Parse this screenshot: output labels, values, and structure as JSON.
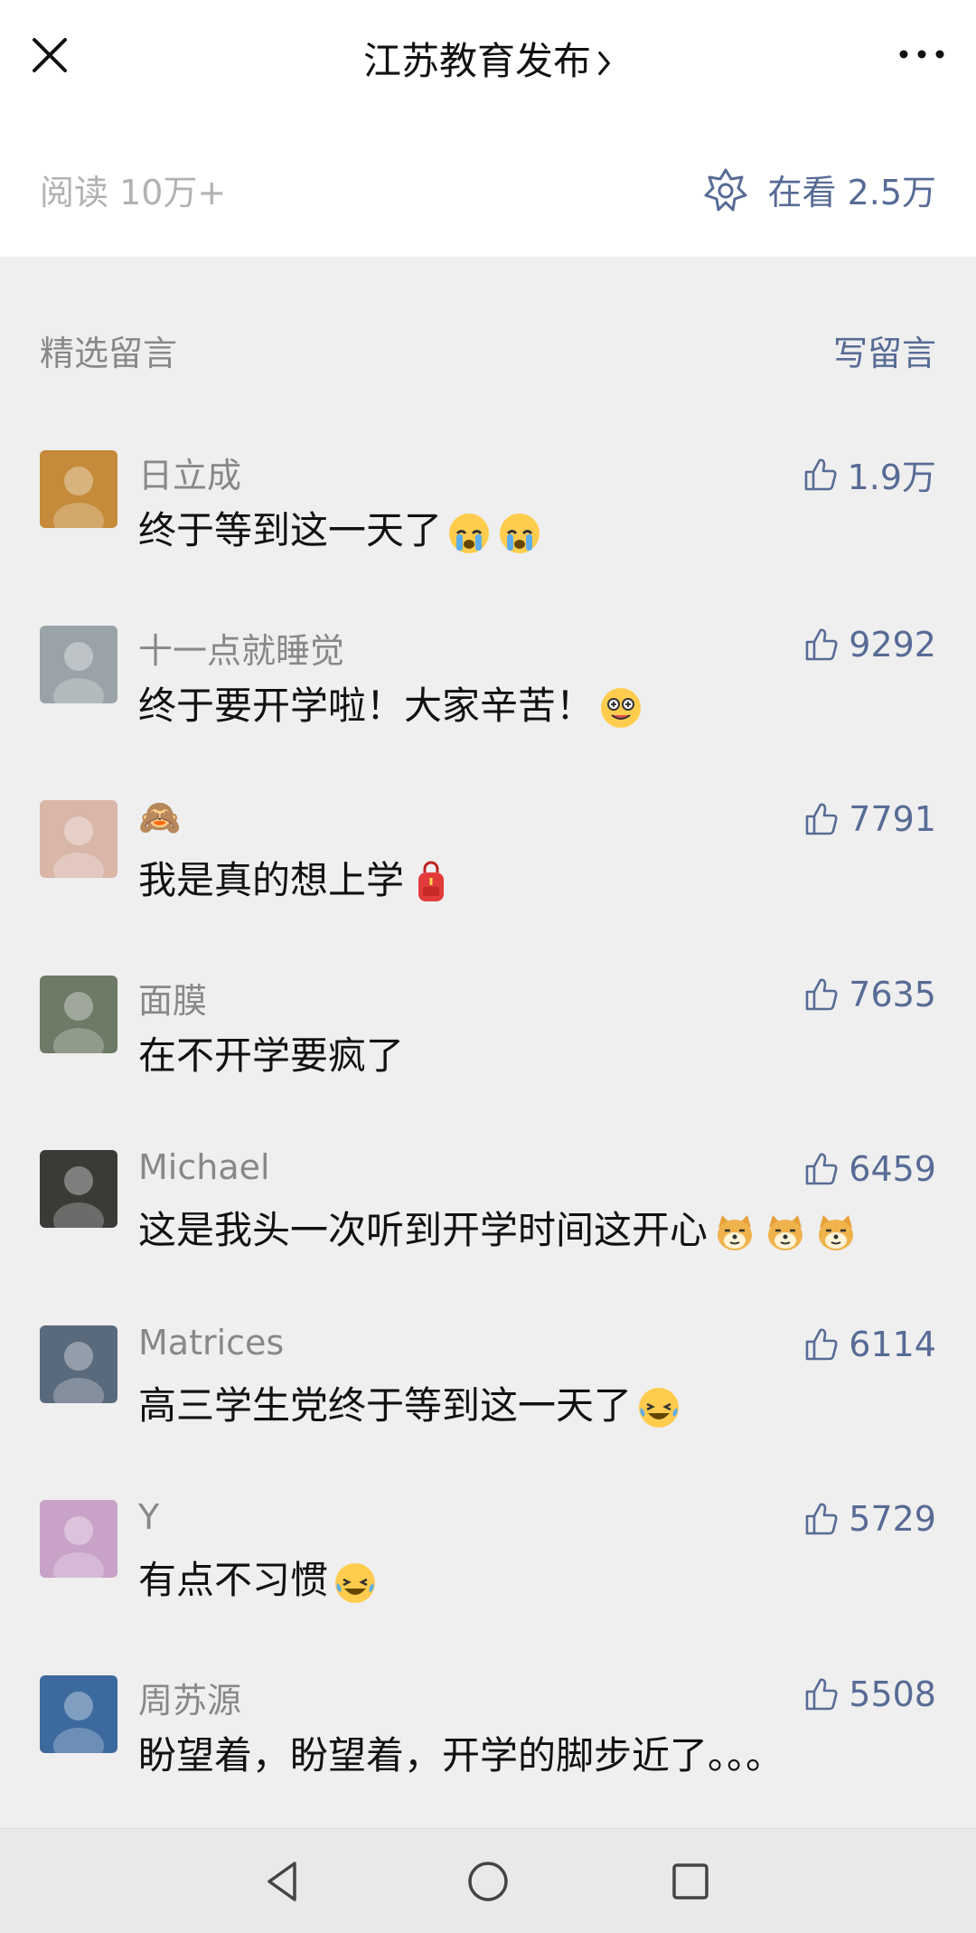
{
  "header": {
    "account_name": "江苏教育发布",
    "close_icon": "close-icon",
    "more_icon": "more-dots-icon"
  },
  "stats": {
    "reads": "阅读 10万+",
    "watching": "在看 2.5万",
    "watching_icon": "wow-star-icon"
  },
  "section": {
    "title": "精选留言",
    "write_label": "写留言"
  },
  "comments": [
    {
      "nickname": "日立成",
      "text": "终于等到这一天了",
      "emojis": [
        "crying-face",
        "crying-face"
      ],
      "likes": "1.9万",
      "avatar_color": "#c58b3a"
    },
    {
      "nickname": "十一点就睡觉",
      "text": "终于要开学啦！大家辛苦！",
      "emojis": [
        "dizzy-tongue-face"
      ],
      "likes": "9292",
      "avatar_color": "#9aa3a8"
    },
    {
      "nickname": "🙈",
      "text": "我是真的想上学",
      "emojis": [
        "school-backpack"
      ],
      "likes": "7791",
      "avatar_color": "#d9b6a8"
    },
    {
      "nickname": "面膜",
      "text": "在不开学要疯了",
      "emojis": [],
      "likes": "7635",
      "avatar_color": "#6d7a66"
    },
    {
      "nickname": "Michael",
      "text": "这是我头一次听到开学时间这开心",
      "emojis": [
        "doge",
        "doge",
        "doge"
      ],
      "likes": "6459",
      "avatar_color": "#3b3a37"
    },
    {
      "nickname": "Matrices",
      "text": "高三学生党终于等到这一天了",
      "emojis": [
        "laughing-tears-face"
      ],
      "likes": "6114",
      "avatar_color": "#5a6a7d"
    },
    {
      "nickname": "Y",
      "text": "有点不习惯",
      "emojis": [
        "laughing-tears-face"
      ],
      "likes": "5729",
      "avatar_color": "#c9a2c8"
    },
    {
      "nickname": "周苏源",
      "text": "盼望着，盼望着，开学的脚步近了。。。",
      "emojis": [],
      "likes": "5508",
      "avatar_color": "#3d6a9e"
    }
  ],
  "navbar": {
    "back_icon": "nav-back-triangle-icon",
    "home_icon": "nav-home-circle-icon",
    "recents_icon": "nav-recents-square-icon"
  },
  "colors": {
    "link_blue": "#576b95",
    "muted_gray": "#888888",
    "page_bg": "#efefef"
  }
}
